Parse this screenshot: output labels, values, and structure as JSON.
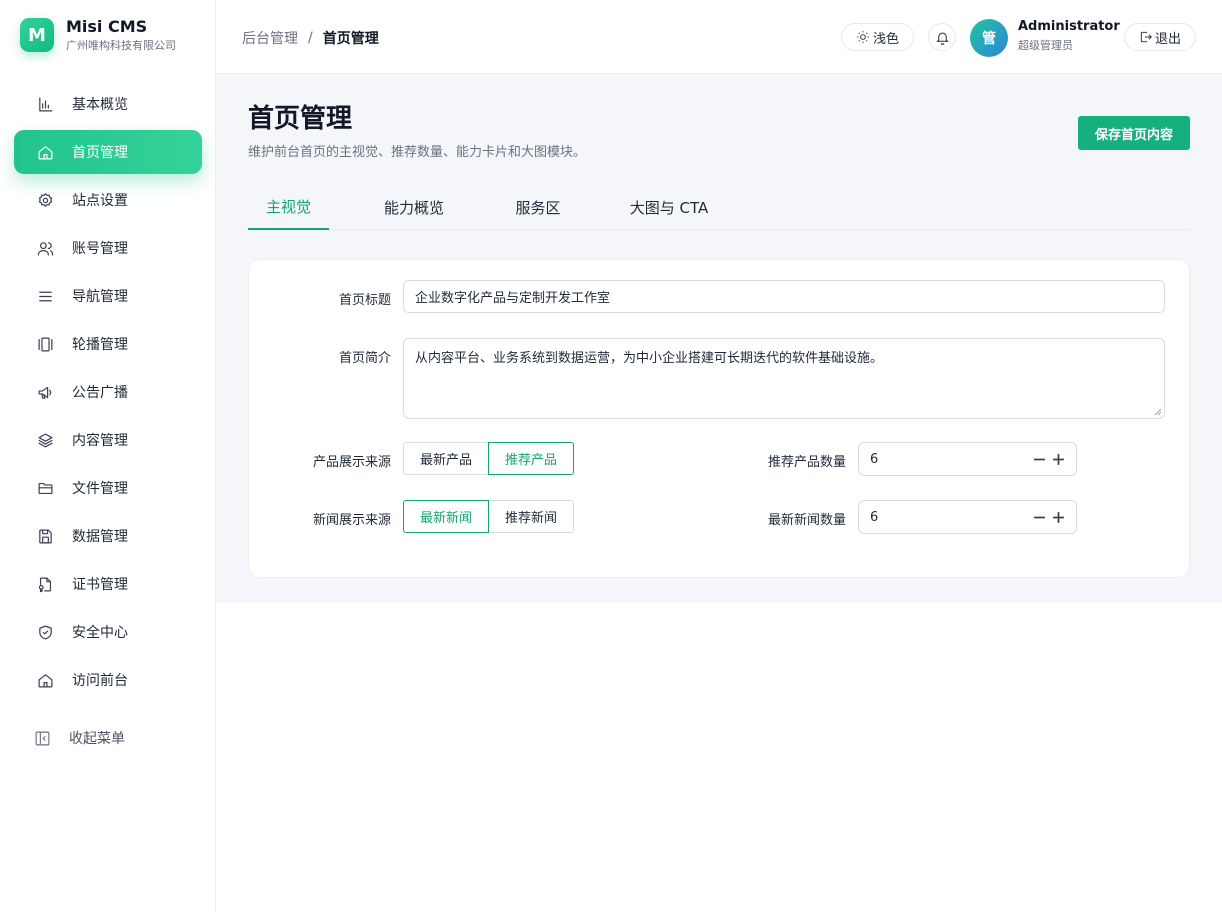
{
  "brand": {
    "logo_letter": "M",
    "name": "Misi CMS",
    "company": "广州唯构科技有限公司"
  },
  "sidebar": {
    "items": [
      {
        "label": "基本概览",
        "icon": "bar-chart-icon",
        "active": false
      },
      {
        "label": "首页管理",
        "icon": "home-icon",
        "active": true
      },
      {
        "label": "站点设置",
        "icon": "gear-icon",
        "active": false
      },
      {
        "label": "账号管理",
        "icon": "users-icon",
        "active": false
      },
      {
        "label": "导航管理",
        "icon": "menu-icon",
        "active": false
      },
      {
        "label": "轮播管理",
        "icon": "carousel-icon",
        "active": false
      },
      {
        "label": "公告广播",
        "icon": "megaphone-icon",
        "active": false
      },
      {
        "label": "内容管理",
        "icon": "layers-icon",
        "active": false
      },
      {
        "label": "文件管理",
        "icon": "folder-icon",
        "active": false
      },
      {
        "label": "数据管理",
        "icon": "save-icon",
        "active": false
      },
      {
        "label": "证书管理",
        "icon": "certificate-icon",
        "active": false
      },
      {
        "label": "安全中心",
        "icon": "shield-icon",
        "active": false
      },
      {
        "label": "访问前台",
        "icon": "home-icon",
        "active": false
      }
    ],
    "collapse_label": "收起菜单"
  },
  "header": {
    "breadcrumb_home": "后台管理",
    "breadcrumb_sep": "/",
    "breadcrumb_current": "首页管理",
    "theme_label": "浅色",
    "avatar_text": "管",
    "user_name": "Administrator",
    "user_role": "超级管理员",
    "logout_label": "退出"
  },
  "page": {
    "title": "首页管理",
    "description": "维护前台首页的主视觉、推荐数量、能力卡片和大图模块。",
    "save_label": "保存首页内容"
  },
  "tabs": [
    {
      "label": "主视觉",
      "active": true
    },
    {
      "label": "能力概览",
      "active": false
    },
    {
      "label": "服务区",
      "active": false
    },
    {
      "label": "大图与 CTA",
      "active": false
    }
  ],
  "form": {
    "title_label": "首页标题",
    "title_value": "企业数字化产品与定制开发工作室",
    "intro_label": "首页简介",
    "intro_value": "从内容平台、业务系统到数据运营，为中小企业搭建可长期迭代的软件基础设施。",
    "product_source_label": "产品展示来源",
    "product_source_options": [
      "最新产品",
      "推荐产品"
    ],
    "product_source_selected": 1,
    "product_count_label": "推荐产品数量",
    "product_count_value": "6",
    "news_source_label": "新闻展示来源",
    "news_source_options": [
      "最新新闻",
      "推荐新闻"
    ],
    "news_source_selected": 0,
    "news_count_label": "最新新闻数量",
    "news_count_value": "6"
  },
  "colors": {
    "accent": "#16a372",
    "accent_button": "#16b07e",
    "main_bg": "#f4f6f9"
  }
}
